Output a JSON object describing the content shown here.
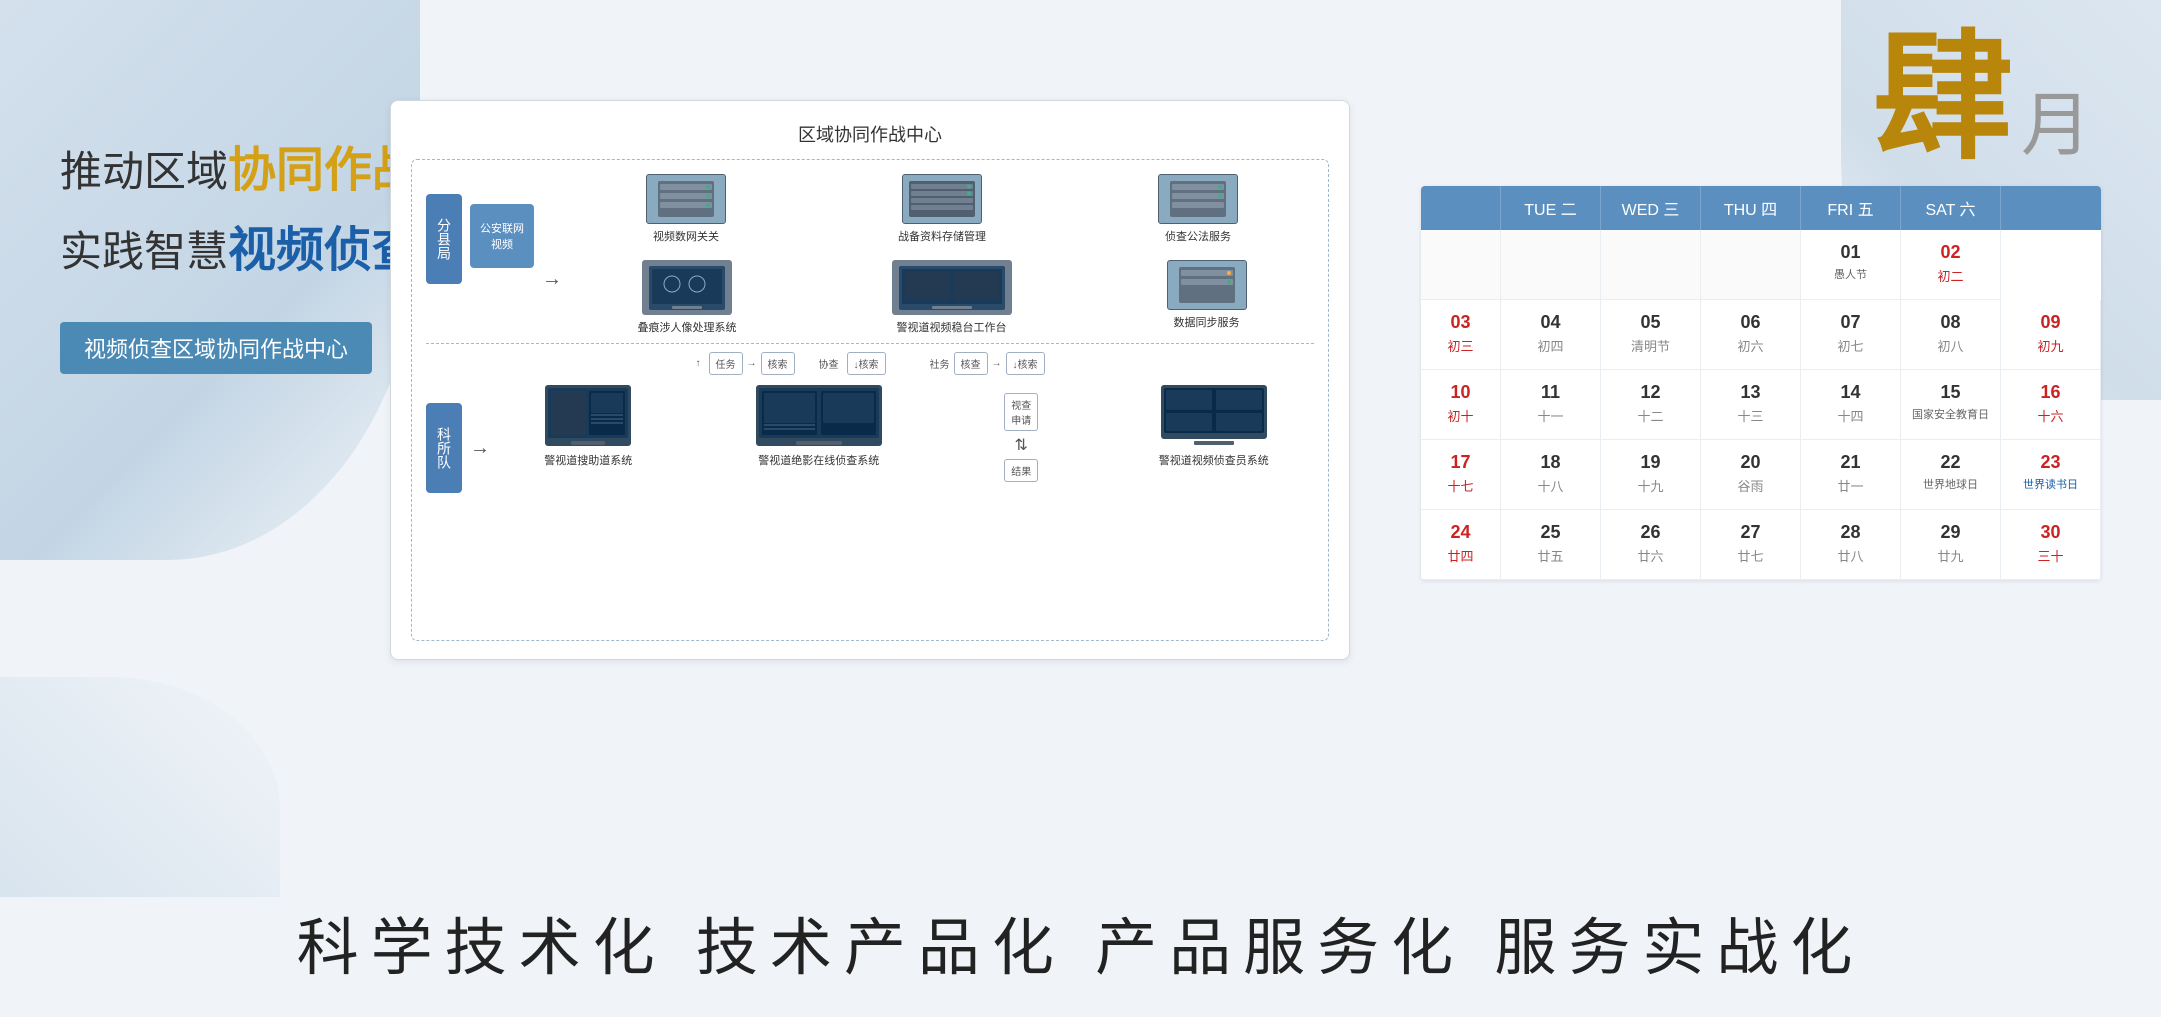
{
  "background": {
    "color": "#f0f4f8"
  },
  "left_panel": {
    "line1_normal": "推动区域",
    "line1_bold": "协同作战",
    "line2_normal": "实践智慧",
    "line2_bold": "视频侦查",
    "subtitle": "视频侦查区域协同作战中心"
  },
  "diagram": {
    "title": "区域协同作战中心",
    "branch_label": "分县局",
    "network_label": "公安联网视频",
    "substation_label": "科所队",
    "top_devices": [
      {
        "label": "视频数网关关",
        "type": "server"
      },
      {
        "label": "战备资料存储管理",
        "type": "server"
      },
      {
        "label": "侦查公法服务",
        "type": "server"
      }
    ],
    "top_devices2": [
      {
        "label": "叠痕涉人像处理系统",
        "type": "workstation"
      },
      {
        "label": "警视道视频稳台工作台",
        "type": "workstation"
      },
      {
        "label": "数据同步服务",
        "type": "server"
      }
    ],
    "flow_labels": [
      "任务",
      "核索",
      "协查",
      "核索"
    ],
    "flow_labels2": [
      "社务",
      "核查",
      "协查",
      "核索"
    ],
    "bottom_devices": [
      {
        "label": "警视道搜助道系统",
        "type": "computer"
      },
      {
        "label": "警视道绝影在线侦查系统",
        "type": "computer"
      },
      {
        "label": "警视道视频侦查员系统",
        "type": "monitor"
      }
    ]
  },
  "calendar": {
    "month_big": "肆",
    "month_small": "月",
    "headers": [
      "",
      "TUE 二",
      "WED 三",
      "THU 四",
      "FRI 五",
      "SAT 六"
    ],
    "week1": [
      {
        "num": "",
        "lunar": "",
        "type": "empty"
      },
      {
        "num": "",
        "lunar": "",
        "type": "empty"
      },
      {
        "num": "",
        "lunar": "",
        "type": "empty"
      },
      {
        "num": "01",
        "lunar": "愚人节",
        "type": "festival"
      },
      {
        "num": "02",
        "lunar": "初二",
        "type": "red-day"
      }
    ],
    "week2": [
      {
        "num": "03",
        "lunar": "初三",
        "type": "red-day"
      },
      {
        "num": "04",
        "lunar": "初四",
        "type": "normal"
      },
      {
        "num": "05",
        "lunar": "清明节",
        "type": "normal"
      },
      {
        "num": "06",
        "lunar": "初六",
        "type": "normal"
      },
      {
        "num": "07",
        "lunar": "初七",
        "type": "normal"
      },
      {
        "num": "08",
        "lunar": "初八",
        "type": "normal"
      },
      {
        "num": "09",
        "lunar": "初九",
        "type": "red-day"
      }
    ],
    "week3": [
      {
        "num": "10",
        "lunar": "初十",
        "type": "red-day"
      },
      {
        "num": "11",
        "lunar": "十一",
        "type": "normal"
      },
      {
        "num": "12",
        "lunar": "十二",
        "type": "normal"
      },
      {
        "num": "13",
        "lunar": "十三",
        "type": "normal"
      },
      {
        "num": "14",
        "lunar": "十四",
        "type": "normal"
      },
      {
        "num": "15",
        "lunar": "国家安全教育日",
        "type": "normal"
      },
      {
        "num": "16",
        "lunar": "十六",
        "type": "red-day"
      }
    ],
    "week4": [
      {
        "num": "17",
        "lunar": "十七",
        "type": "red-day"
      },
      {
        "num": "18",
        "lunar": "十八",
        "type": "normal"
      },
      {
        "num": "19",
        "lunar": "十九",
        "type": "normal"
      },
      {
        "num": "20",
        "lunar": "谷雨",
        "type": "normal"
      },
      {
        "num": "21",
        "lunar": "廿一",
        "type": "normal"
      },
      {
        "num": "22",
        "lunar": "世界地球日",
        "type": "normal"
      },
      {
        "num": "23",
        "lunar": "世界读书日",
        "type": "red-special"
      }
    ],
    "week5": [
      {
        "num": "24",
        "lunar": "廿四",
        "type": "red-day"
      },
      {
        "num": "25",
        "lunar": "廿五",
        "type": "normal"
      },
      {
        "num": "26",
        "lunar": "廿六",
        "type": "normal"
      },
      {
        "num": "27",
        "lunar": "廿七",
        "type": "normal"
      },
      {
        "num": "28",
        "lunar": "廿八",
        "type": "normal"
      },
      {
        "num": "29",
        "lunar": "廿九",
        "type": "normal"
      },
      {
        "num": "30",
        "lunar": "三十",
        "type": "red-day"
      }
    ]
  },
  "bottom_slogan": "科学技术化  技术产品化  产品服务化  服务实战化"
}
